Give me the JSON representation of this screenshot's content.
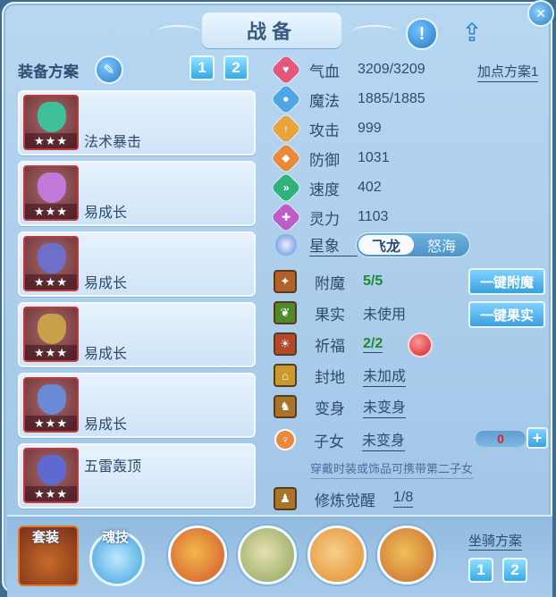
{
  "window": {
    "title": "战备",
    "close_glyph": "✕"
  },
  "header": {
    "info_glyph": "!",
    "share_glyph": "⇪"
  },
  "equip_plan": {
    "label": "装备方案",
    "edit_glyph": "✎",
    "plans": [
      "1",
      "2"
    ]
  },
  "equipment": [
    {
      "name": "法术暴击",
      "stars": "★★★",
      "color": "#3fbf9a"
    },
    {
      "name": "易成长",
      "stars": "★★★",
      "color": "#c079d8"
    },
    {
      "name": "易成长",
      "stars": "★★★",
      "color": "#6e6fc9"
    },
    {
      "name": "易成长",
      "stars": "★★★",
      "color": "#c9a04a"
    },
    {
      "name": "易成长",
      "stars": "★★★",
      "color": "#6a8ad6"
    },
    {
      "name": "五雷轰顶",
      "stars": "★★★",
      "color": "#5f6ad1"
    }
  ],
  "attributes": [
    {
      "name": "气血",
      "value": "3209/3209",
      "color": "#e2577b",
      "glyph": "♥"
    },
    {
      "name": "魔法",
      "value": "1885/1885",
      "color": "#4fa6e6",
      "glyph": "●"
    },
    {
      "name": "攻击",
      "value": "999",
      "color": "#e8a43a",
      "glyph": "↑"
    },
    {
      "name": "防御",
      "value": "1031",
      "color": "#e88a3a",
      "glyph": "◆"
    },
    {
      "name": "速度",
      "value": "402",
      "color": "#2fb37a",
      "glyph": "»"
    },
    {
      "name": "灵力",
      "value": "1103",
      "color": "#c05cc7",
      "glyph": "✚"
    }
  ],
  "point_plan": "加点方案1",
  "constellation": {
    "label": "星象",
    "options": [
      "飞龙",
      "怒海"
    ],
    "active": "飞龙"
  },
  "specials": [
    {
      "name": "附魔",
      "value": "5/5",
      "style": "green",
      "icon_color": "#b3612b"
    },
    {
      "name": "果实",
      "value": "未使用",
      "style": "plain",
      "icon_color": "#4e8a2b"
    },
    {
      "name": "祈福",
      "value": "2/2",
      "style": "green-under",
      "icon_color": "#b04a2b"
    },
    {
      "name": "封地",
      "value": "未加成",
      "style": "under",
      "icon_color": "#c99a2b"
    },
    {
      "name": "变身",
      "value": "未变身",
      "style": "under",
      "icon_color": "#a8742b"
    },
    {
      "name": "子女",
      "value": "未变身",
      "style": "under",
      "icon_color": "#e88a3a"
    }
  ],
  "buttons": {
    "enchant_all": "一键附魔",
    "fruit_all": "一键果实",
    "plus": "+"
  },
  "children_counter": "0",
  "hint": "穿戴时装或饰品可携带第二子女",
  "cultivation": {
    "name": "修炼觉醒",
    "value": "1/8"
  },
  "bottom": {
    "set_label": "套装",
    "soul_label": "魂技",
    "skills": [
      {
        "name": "skill-1",
        "color": "#d2542f"
      },
      {
        "name": "skill-2",
        "color": "#8ba45a"
      },
      {
        "name": "skill-3",
        "color": "#e38a2e"
      },
      {
        "name": "skill-4",
        "color": "#c96a2b"
      }
    ],
    "mount_label": "坐骑方案",
    "mount_plans": [
      "1",
      "2"
    ]
  }
}
